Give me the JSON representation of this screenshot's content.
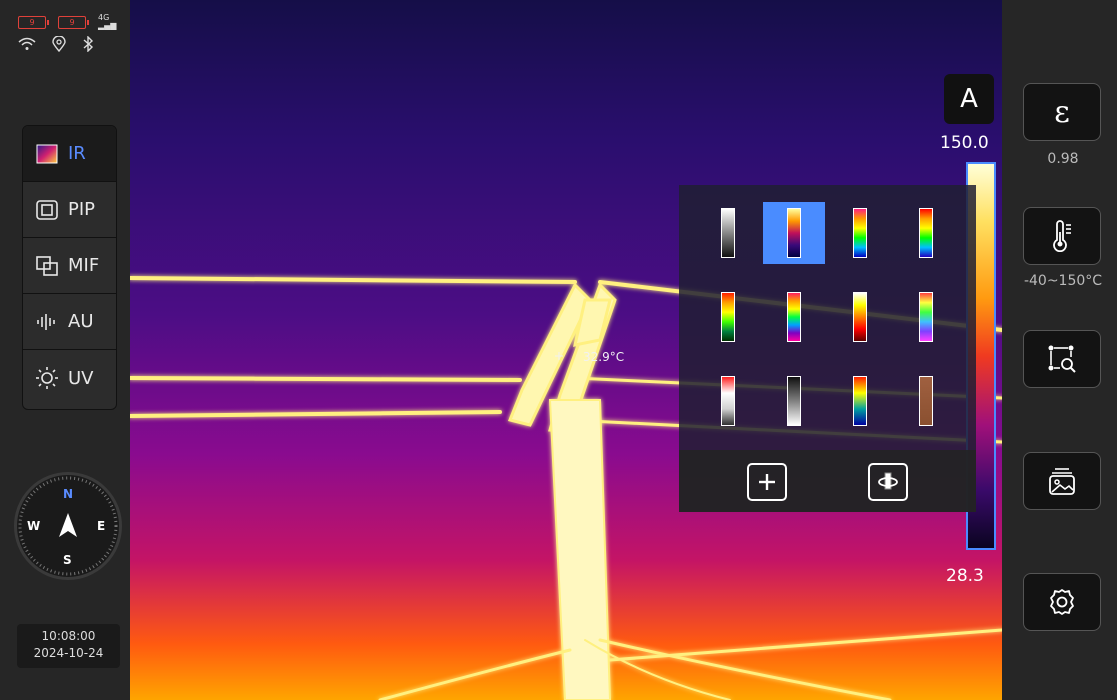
{
  "status_bar": {
    "battery_1": "9",
    "battery_2": "9",
    "network": "4G"
  },
  "mode_list": [
    {
      "label": "IR",
      "icon": "ir-image-icon",
      "active": true
    },
    {
      "label": "PIP",
      "icon": "pip-icon",
      "active": false
    },
    {
      "label": "MIF",
      "icon": "mif-icon",
      "active": false
    },
    {
      "label": "AU",
      "icon": "audio-waveform-icon",
      "active": false
    },
    {
      "label": "UV",
      "icon": "uv-sun-icon",
      "active": false
    }
  ],
  "compass": {
    "n": "N",
    "s": "S",
    "e": "E",
    "w": "W"
  },
  "clock": {
    "time": "10:08:00",
    "date": "2024-10-24"
  },
  "measurement": {
    "label": "32.9°C"
  },
  "scale": {
    "mode": "A",
    "max": "150.0",
    "min": "28.3"
  },
  "palette_picker": {
    "selected_index": 1,
    "palettes": [
      {
        "name": "white-hot",
        "gradient": "linear-gradient(180deg,#ffffff,#101010)"
      },
      {
        "name": "ironbow",
        "gradient": "linear-gradient(180deg,#ffffa0,#ff9a00,#c0105a,#3a0a7a,#000040)"
      },
      {
        "name": "rainbow-1",
        "gradient": "linear-gradient(180deg,#ff2080,#ff9a00,#ffff00,#00ff00,#00c0ff,#0000c0)"
      },
      {
        "name": "rainbow-2",
        "gradient": "linear-gradient(180deg,#ff0000,#ffa000,#ffff00,#00ff00,#00c0ff,#2000c0)"
      },
      {
        "name": "rainbow-3",
        "gradient": "linear-gradient(180deg,#ff2000,#ffa000,#ffff00,#40ff00,#008040,#003000)"
      },
      {
        "name": "rainbow-hc",
        "gradient": "linear-gradient(180deg,#ff2060,#ffa000,#ffff00,#00ff40,#00a0ff,#8000c0,#ff00a0)"
      },
      {
        "name": "red-hot",
        "gradient": "linear-gradient(180deg,#ffffff,#ffff00,#ff8000,#ff0000,#600000)"
      },
      {
        "name": "arctic",
        "gradient": "linear-gradient(180deg,#ff4040,#ffff40,#40ff40,#40c0ff,#8040ff,#ff40ff)"
      },
      {
        "name": "red-white",
        "gradient": "linear-gradient(180deg,#ff2020,#ffffff,#d0d0d0,#303030)"
      },
      {
        "name": "black-hot",
        "gradient": "linear-gradient(180deg,#101010,#808080,#ffffff)"
      },
      {
        "name": "medical",
        "gradient": "linear-gradient(180deg,#ff2000,#ffff00,#00a0a0,#0000a0)"
      },
      {
        "name": "sepia",
        "gradient": "linear-gradient(180deg,#a06040,#8a5030)"
      }
    ]
  },
  "right_bar": {
    "emissivity": {
      "symbol": "ε",
      "value": "0.98"
    },
    "range": {
      "value": "-40~150°C"
    }
  },
  "colors": {
    "accent": "#4a8cff",
    "panel": "#262626"
  }
}
